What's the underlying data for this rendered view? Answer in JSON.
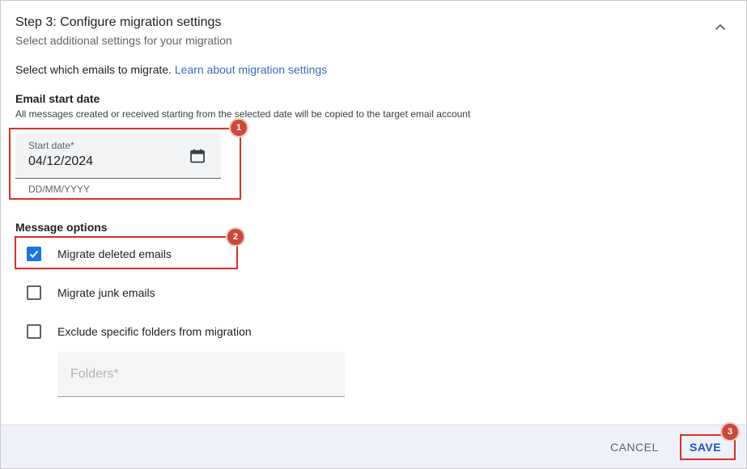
{
  "step": {
    "title": "Step 3: Configure migration settings",
    "subtitle": "Select additional settings for your migration"
  },
  "intro": {
    "text": "Select which emails to migrate. ",
    "link": "Learn about migration settings"
  },
  "email_start": {
    "heading": "Email start date",
    "description": "All messages created or received starting from the selected date will be copied to the target email account",
    "field_label": "Start date*",
    "field_value": "04/12/2024",
    "hint": "DD/MM/YYYY"
  },
  "message_options": {
    "heading": "Message options",
    "items": [
      {
        "label": "Migrate deleted emails",
        "checked": true
      },
      {
        "label": "Migrate junk emails",
        "checked": false
      },
      {
        "label": "Exclude specific folders from migration",
        "checked": false
      }
    ],
    "folders_placeholder": "Folders*"
  },
  "footer": {
    "cancel_label": "CANCEL",
    "save_label": "SAVE"
  },
  "annotations": {
    "markers": [
      "1",
      "2",
      "3"
    ],
    "color": "#d93025"
  },
  "colors": {
    "accent": "#1a73e8",
    "link": "#3c6bc4",
    "footer_bg": "#eef1f9"
  },
  "icons": {
    "collapse": "chevron-up-icon",
    "calendar": "calendar-icon",
    "check": "check-icon"
  }
}
